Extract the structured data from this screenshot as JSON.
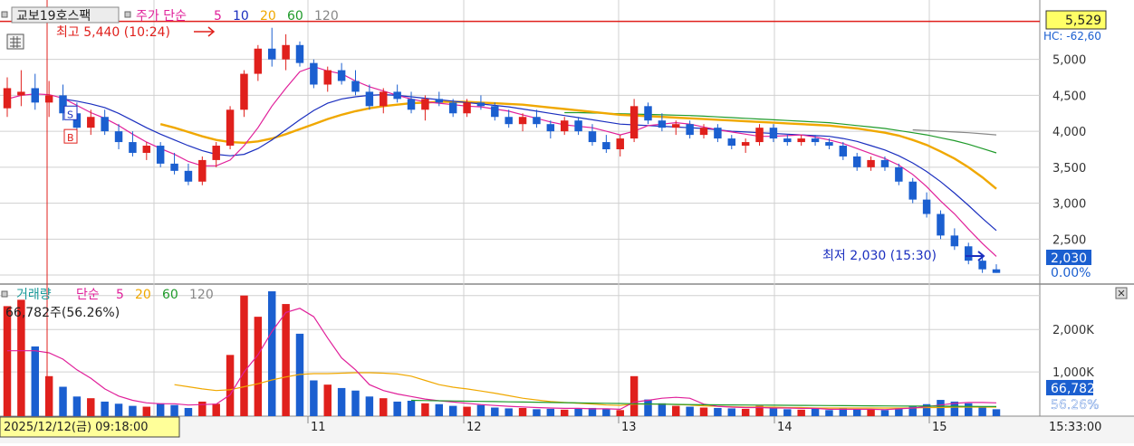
{
  "price_panel": {
    "stock_name": "교보19호스팩",
    "indicator_label": "주가 단순",
    "ma_periods": [
      "5",
      "10",
      "20",
      "60",
      "120"
    ],
    "ma_colors": [
      "#e0209a",
      "#1b2fbf",
      "#f0a800",
      "#1f9a2a",
      "#888888"
    ],
    "high_marker": "최고 5,440 (10:24)",
    "low_marker": "최저 2,030 (15:30)",
    "current_price_box": "5,529",
    "current_price_label_2": "HC: -62,60",
    "last_price_box": "2,030",
    "last_pct": "0.00%",
    "y_ticks": [
      "5,000",
      "4,500",
      "4,000",
      "3,500",
      "3,000",
      "2,500"
    ],
    "buy_marker": "B",
    "sell_marker": "S"
  },
  "volume_panel": {
    "title": "거래량",
    "indicator_label": "단순",
    "ma_periods": [
      "5",
      "20",
      "60",
      "120"
    ],
    "ma_colors": [
      "#e0209a",
      "#f0a800",
      "#1f9a2a",
      "#888888"
    ],
    "summary": "66,782주(56.26%)",
    "y_ticks": [
      "2,000K",
      "1,000K"
    ],
    "last_volume_box": "66,782",
    "last_volume_pct": "56.26%"
  },
  "x_axis": {
    "cursor_label": "2025/12/12(금) 09:18:00",
    "day_labels": [
      "11",
      "12",
      "13",
      "14",
      "15"
    ],
    "time_label": "15:33:00"
  },
  "colors": {
    "up": "#e0201c",
    "down": "#1b5fd0",
    "high_line": "#e0201c",
    "cursor_line": "#e0201c",
    "price_box_bg": "#ffff66",
    "volume_box_bg": "#1b5fd0"
  },
  "chart_data": {
    "type": "candlestick",
    "price_range": [
      1900,
      5600
    ],
    "volume_range": [
      0,
      2900
    ],
    "volume_unit": "K",
    "high_price_line": 5529,
    "candles": [
      [
        4320,
        4750,
        4200,
        4600
      ],
      [
        4500,
        4850,
        4350,
        4550
      ],
      [
        4600,
        4800,
        4300,
        4400
      ],
      [
        4400,
        4700,
        4200,
        4500
      ],
      [
        4500,
        4650,
        4150,
        4250
      ],
      [
        4250,
        4400,
        3950,
        4050
      ],
      [
        4050,
        4300,
        3950,
        4200
      ],
      [
        4200,
        4300,
        3950,
        4000
      ],
      [
        4000,
        4100,
        3750,
        3850
      ],
      [
        3850,
        4000,
        3650,
        3700
      ],
      [
        3700,
        3850,
        3600,
        3800
      ],
      [
        3800,
        3850,
        3500,
        3550
      ],
      [
        3550,
        3700,
        3400,
        3450
      ],
      [
        3450,
        3550,
        3250,
        3300
      ],
      [
        3300,
        3650,
        3250,
        3600
      ],
      [
        3600,
        3850,
        3500,
        3800
      ],
      [
        3800,
        4350,
        3750,
        4300
      ],
      [
        4300,
        4850,
        4200,
        4800
      ],
      [
        4800,
        5200,
        4700,
        5150
      ],
      [
        5150,
        5440,
        4900,
        5000
      ],
      [
        5000,
        5350,
        4850,
        5200
      ],
      [
        5200,
        5250,
        4900,
        4950
      ],
      [
        4950,
        5000,
        4600,
        4650
      ],
      [
        4650,
        4900,
        4550,
        4850
      ],
      [
        4850,
        4950,
        4650,
        4700
      ],
      [
        4700,
        4850,
        4500,
        4550
      ],
      [
        4550,
        4650,
        4300,
        4350
      ],
      [
        4350,
        4600,
        4250,
        4550
      ],
      [
        4550,
        4650,
        4400,
        4450
      ],
      [
        4450,
        4550,
        4250,
        4300
      ],
      [
        4300,
        4500,
        4150,
        4450
      ],
      [
        4450,
        4550,
        4350,
        4400
      ],
      [
        4400,
        4450,
        4200,
        4250
      ],
      [
        4250,
        4450,
        4200,
        4400
      ],
      [
        4400,
        4500,
        4300,
        4350
      ],
      [
        4350,
        4400,
        4150,
        4200
      ],
      [
        4200,
        4300,
        4050,
        4100
      ],
      [
        4100,
        4250,
        4000,
        4200
      ],
      [
        4200,
        4300,
        4050,
        4100
      ],
      [
        4100,
        4150,
        3900,
        4000
      ],
      [
        4000,
        4200,
        3950,
        4150
      ],
      [
        4150,
        4200,
        3950,
        4000
      ],
      [
        4000,
        4100,
        3800,
        3850
      ],
      [
        3850,
        3950,
        3700,
        3750
      ],
      [
        3750,
        3950,
        3650,
        3900
      ],
      [
        3900,
        4450,
        3850,
        4350
      ],
      [
        4350,
        4400,
        4100,
        4150
      ],
      [
        4150,
        4250,
        4000,
        4050
      ],
      [
        4050,
        4150,
        3950,
        4100
      ],
      [
        4100,
        4150,
        3900,
        3950
      ],
      [
        3950,
        4100,
        3900,
        4050
      ],
      [
        4050,
        4100,
        3850,
        3900
      ],
      [
        3900,
        3950,
        3750,
        3800
      ],
      [
        3800,
        3900,
        3700,
        3850
      ],
      [
        3850,
        4100,
        3800,
        4050
      ],
      [
        4050,
        4100,
        3850,
        3900
      ],
      [
        3900,
        3950,
        3800,
        3850
      ],
      [
        3850,
        3950,
        3800,
        3900
      ],
      [
        3900,
        3950,
        3800,
        3850
      ],
      [
        3850,
        3900,
        3750,
        3800
      ],
      [
        3800,
        3850,
        3600,
        3650
      ],
      [
        3650,
        3700,
        3450,
        3500
      ],
      [
        3500,
        3650,
        3450,
        3600
      ],
      [
        3600,
        3650,
        3450,
        3500
      ],
      [
        3500,
        3550,
        3250,
        3300
      ],
      [
        3300,
        3350,
        3000,
        3050
      ],
      [
        3050,
        3150,
        2800,
        2850
      ],
      [
        2850,
        2900,
        2500,
        2550
      ],
      [
        2550,
        2650,
        2350,
        2400
      ],
      [
        2400,
        2450,
        2150,
        2200
      ],
      [
        2200,
        2250,
        2030,
        2080
      ],
      [
        2080,
        2150,
        2030,
        2030
      ]
    ],
    "volumes": [
      2550,
      2700,
      1600,
      900,
      650,
      420,
      380,
      300,
      250,
      200,
      180,
      260,
      220,
      150,
      300,
      250,
      1400,
      2800,
      2300,
      2900,
      2600,
      1900,
      800,
      700,
      620,
      560,
      420,
      380,
      300,
      320,
      260,
      240,
      200,
      180,
      220,
      160,
      140,
      150,
      120,
      130,
      110,
      140,
      150,
      120,
      100,
      900,
      350,
      260,
      200,
      180,
      160,
      150,
      140,
      130,
      200,
      140,
      120,
      110,
      130,
      100,
      140,
      120,
      110,
      100,
      160,
      180,
      240,
      340,
      300,
      260,
      190,
      120
    ],
    "ma5": [
      4450,
      4500,
      4520,
      4510,
      4460,
      4360,
      4260,
      4180,
      4080,
      3960,
      3850,
      3760,
      3680,
      3580,
      3520,
      3520,
      3600,
      3800,
      4050,
      4350,
      4600,
      4830,
      4900,
      4840,
      4800,
      4700,
      4620,
      4560,
      4500,
      4450,
      4410,
      4390,
      4370,
      4350,
      4340,
      4310,
      4280,
      4230,
      4180,
      4130,
      4090,
      4070,
      4050,
      4000,
      3950,
      4000,
      4080,
      4100,
      4120,
      4100,
      4060,
      4020,
      3990,
      3960,
      3930,
      3930,
      3940,
      3950,
      3920,
      3880,
      3830,
      3760,
      3690,
      3620,
      3530,
      3400,
      3230,
      3030,
      2850,
      2640,
      2440,
      2260
    ],
    "ma10": [
      null,
      null,
      null,
      null,
      4450,
      4420,
      4380,
      4330,
      4250,
      4150,
      4050,
      3960,
      3880,
      3800,
      3730,
      3680,
      3660,
      3680,
      3760,
      3880,
      4020,
      4160,
      4290,
      4390,
      4450,
      4480,
      4500,
      4510,
      4500,
      4480,
      4460,
      4440,
      4420,
      4400,
      4380,
      4360,
      4340,
      4310,
      4280,
      4250,
      4220,
      4190,
      4160,
      4130,
      4100,
      4090,
      4080,
      4070,
      4060,
      4050,
      4040,
      4020,
      4000,
      3990,
      3980,
      3970,
      3960,
      3950,
      3940,
      3930,
      3900,
      3860,
      3800,
      3740,
      3660,
      3560,
      3440,
      3300,
      3140,
      2970,
      2790,
      2620
    ],
    "ma20": [
      null,
      null,
      null,
      null,
      null,
      null,
      null,
      null,
      null,
      null,
      null,
      4100,
      4050,
      3990,
      3930,
      3880,
      3850,
      3840,
      3860,
      3900,
      3960,
      4030,
      4100,
      4170,
      4230,
      4280,
      4320,
      4350,
      4370,
      4390,
      4400,
      4410,
      4410,
      4410,
      4400,
      4390,
      4380,
      4370,
      4350,
      4330,
      4310,
      4290,
      4270,
      4250,
      4230,
      4220,
      4210,
      4200,
      4190,
      4180,
      4170,
      4160,
      4150,
      4140,
      4130,
      4120,
      4110,
      4100,
      4090,
      4080,
      4060,
      4040,
      4010,
      3980,
      3940,
      3880,
      3810,
      3720,
      3620,
      3500,
      3360,
      3200
    ],
    "ma60": [
      null,
      null,
      null,
      null,
      null,
      null,
      null,
      null,
      null,
      null,
      null,
      null,
      null,
      null,
      null,
      null,
      null,
      null,
      null,
      null,
      null,
      null,
      null,
      null,
      null,
      null,
      null,
      null,
      null,
      null,
      null,
      null,
      null,
      null,
      null,
      null,
      null,
      null,
      null,
      null,
      4260,
      4260,
      4255,
      4250,
      4245,
      4240,
      4235,
      4230,
      4225,
      4220,
      4210,
      4200,
      4190,
      4180,
      4170,
      4160,
      4150,
      4140,
      4130,
      4120,
      4100,
      4080,
      4060,
      4040,
      4010,
      3980,
      3950,
      3910,
      3870,
      3820,
      3760,
      3700
    ],
    "ma120": [
      null,
      null,
      null,
      null,
      null,
      null,
      null,
      null,
      null,
      null,
      null,
      null,
      null,
      null,
      null,
      null,
      null,
      null,
      null,
      null,
      null,
      null,
      null,
      null,
      null,
      null,
      null,
      null,
      null,
      null,
      null,
      null,
      null,
      null,
      null,
      null,
      null,
      null,
      null,
      null,
      null,
      null,
      null,
      null,
      null,
      null,
      null,
      null,
      null,
      null,
      null,
      null,
      null,
      null,
      null,
      null,
      null,
      null,
      null,
      null,
      null,
      null,
      null,
      null,
      null,
      4020,
      4010,
      4000,
      3990,
      3980,
      3965,
      3950
    ],
    "vol_ma5": [
      1500,
      1500,
      1500,
      1450,
      1300,
      1050,
      850,
      600,
      430,
      330,
      270,
      250,
      250,
      220,
      230,
      240,
      460,
      1000,
      1400,
      1950,
      2400,
      2500,
      2300,
      1800,
      1330,
      1050,
      700,
      560,
      480,
      420,
      360,
      320,
      290,
      260,
      230,
      210,
      190,
      175,
      160,
      150,
      140,
      140,
      130,
      130,
      120,
      290,
      330,
      380,
      400,
      380,
      240,
      190,
      170,
      160,
      160,
      150,
      150,
      140,
      140,
      120,
      120,
      120,
      120,
      110,
      130,
      150,
      180,
      220,
      260,
      280,
      280,
      270
    ],
    "vol_ma20": [
      null,
      null,
      null,
      null,
      null,
      null,
      null,
      null,
      null,
      null,
      null,
      null,
      700,
      650,
      600,
      560,
      580,
      650,
      720,
      810,
      880,
      940,
      960,
      960,
      970,
      980,
      980,
      970,
      950,
      900,
      800,
      700,
      640,
      600,
      550,
      500,
      440,
      380,
      340,
      300,
      280,
      260,
      240,
      220,
      210,
      240,
      240,
      240,
      230,
      220,
      200,
      190,
      180,
      170,
      170,
      170,
      160,
      160,
      150,
      150,
      150,
      150,
      150,
      150,
      150,
      150,
      160,
      160,
      170,
      170,
      170,
      170
    ],
    "vol_ma60": [
      null,
      null,
      null,
      null,
      null,
      null,
      null,
      null,
      null,
      null,
      null,
      null,
      null,
      null,
      null,
      null,
      null,
      null,
      null,
      null,
      null,
      null,
      null,
      null,
      null,
      null,
      null,
      null,
      null,
      null,
      null,
      null,
      null,
      null,
      null,
      null,
      null,
      null,
      null,
      null,
      null,
      null,
      null,
      null,
      null,
      null,
      null,
      null,
      null,
      null,
      null,
      null,
      null,
      null,
      null,
      null,
      null,
      null,
      null,
      null,
      null,
      null,
      null,
      null,
      null,
      null,
      null,
      null,
      null,
      null,
      null,
      null
    ]
  }
}
